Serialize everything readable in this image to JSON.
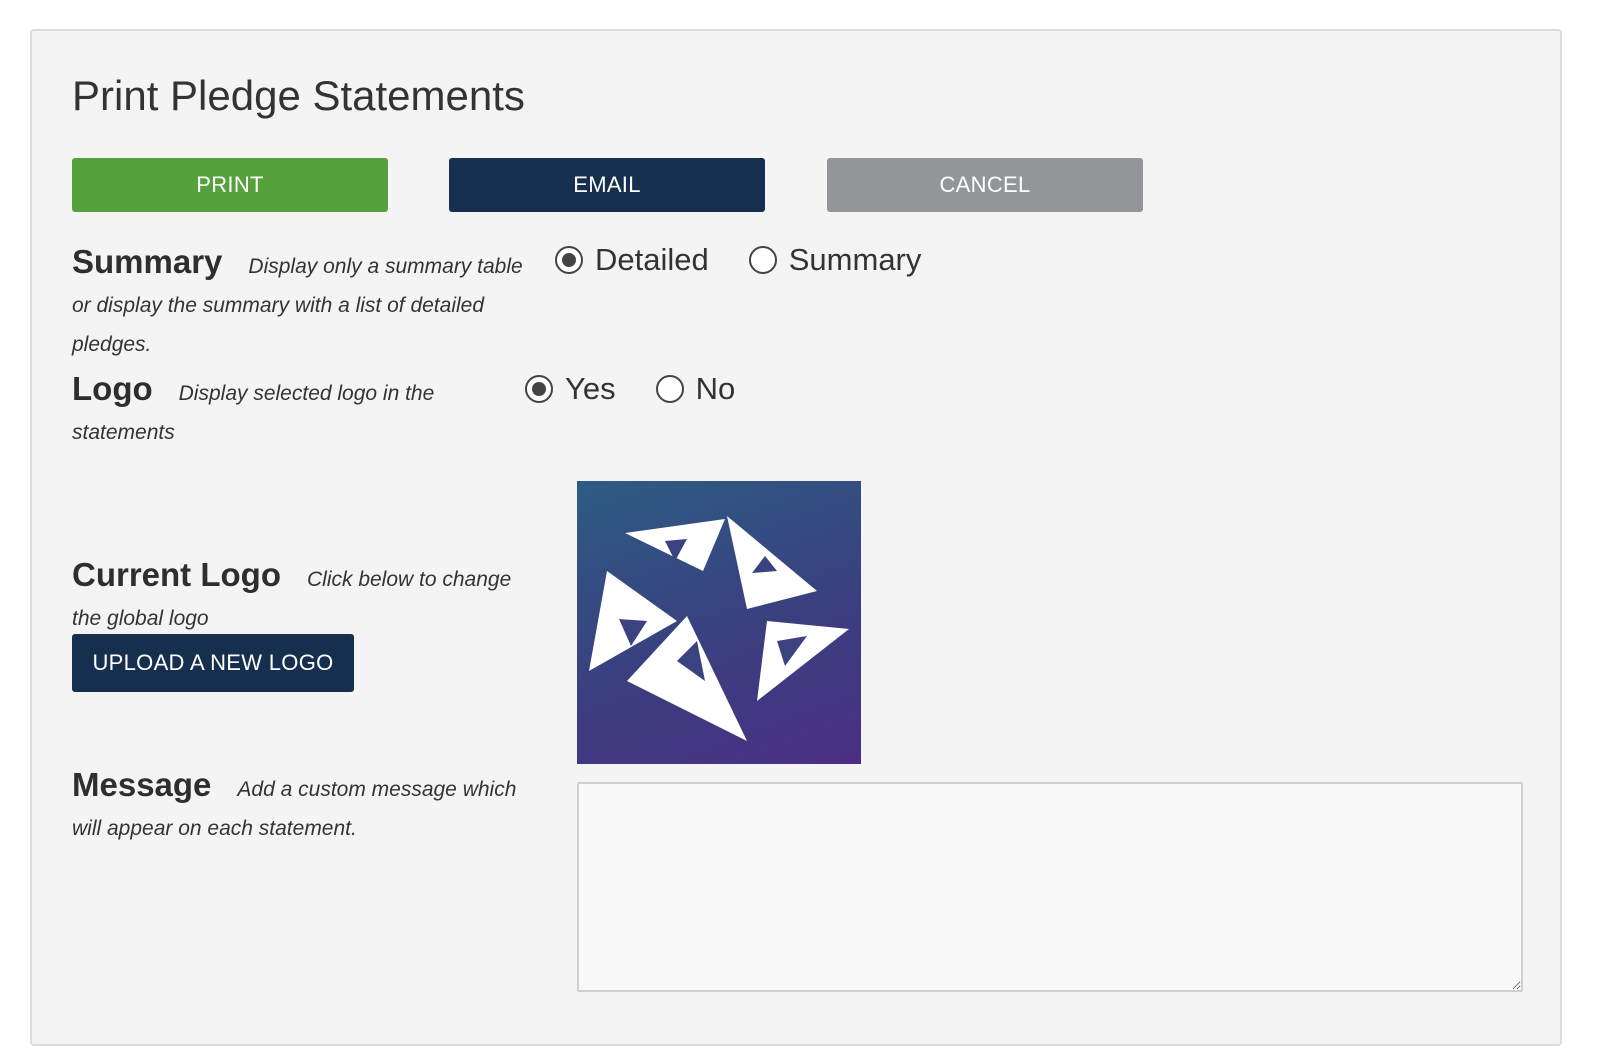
{
  "page": {
    "title": "Print Pledge Statements"
  },
  "actions": {
    "print_label": "PRINT",
    "email_label": "EMAIL",
    "cancel_label": "CANCEL"
  },
  "summary": {
    "heading": "Summary",
    "description": "Display only a summary table or display the summary with a list of detailed pledges.",
    "options": [
      {
        "label": "Detailed",
        "selected": true
      },
      {
        "label": "Summary",
        "selected": false
      }
    ]
  },
  "logo": {
    "heading": "Logo",
    "description": "Display selected logo in the statements",
    "options": [
      {
        "label": "Yes",
        "selected": true
      },
      {
        "label": "No",
        "selected": false
      }
    ]
  },
  "current_logo": {
    "heading": "Current Logo",
    "description": "Click below to change the global logo",
    "upload_label": "UPLOAD A NEW LOGO"
  },
  "message": {
    "heading": "Message",
    "description": "Add a custom message which will appear on each statement.",
    "value": "",
    "placeholder": ""
  },
  "colors": {
    "print": "#55a23d",
    "email": "#172f4e",
    "cancel": "#939598",
    "upload": "#172f4e"
  }
}
